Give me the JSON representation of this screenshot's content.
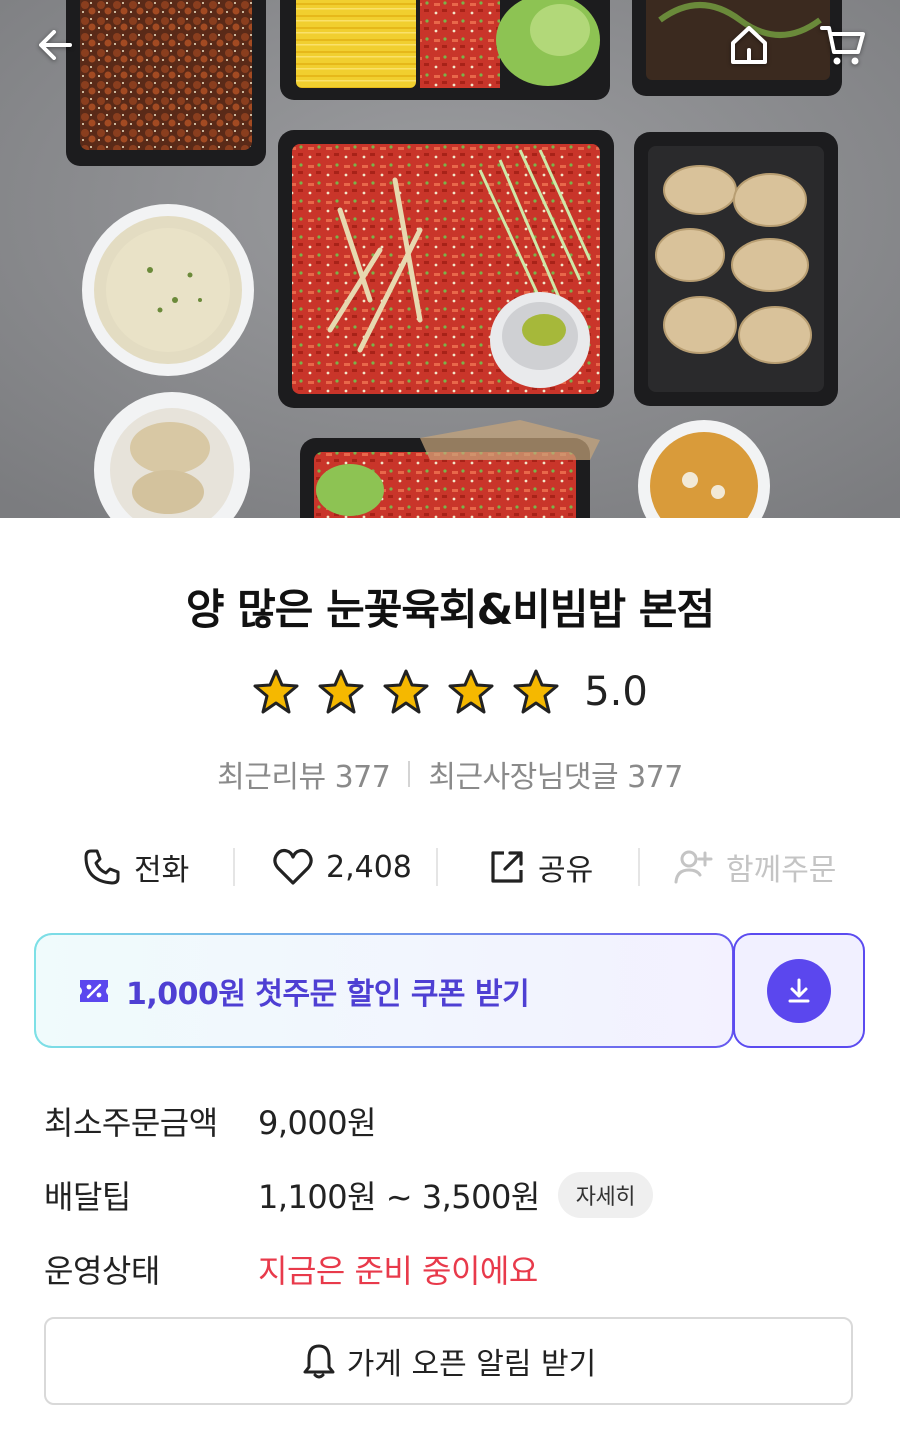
{
  "store": {
    "name": "양 많은 눈꽃육회&비빔밥 본점",
    "rating": "5.0",
    "stars": 5,
    "recent_reviews": "최근리뷰 377",
    "recent_owner_replies": "최근사장님댓글 377"
  },
  "actions": {
    "call_label": "전화",
    "like_count": "2,408",
    "share_label": "공유",
    "group_order_label": "함께주문"
  },
  "coupon": {
    "label": "1,000원 첫주문 할인 쿠폰 받기"
  },
  "info": {
    "min_order_label": "최소주문금액",
    "min_order_value": "9,000원",
    "delivery_tip_label": "배달팁",
    "delivery_tip_value": "1,100원 ~ 3,500원",
    "delivery_tip_detail": "자세히",
    "status_label": "운영상태",
    "status_value": "지금은 준비 중이에요"
  },
  "alert_button_label": "가게 오픈 알림 받기",
  "colors": {
    "accent_purple": "#5b47ee",
    "status_red": "#e83a4b",
    "star_gold": "#f5b800"
  },
  "icons": [
    "back-arrow-icon",
    "home-icon",
    "cart-icon",
    "phone-icon",
    "heart-icon",
    "share-icon",
    "add-person-icon",
    "coupon-icon",
    "download-icon",
    "bell-icon"
  ]
}
